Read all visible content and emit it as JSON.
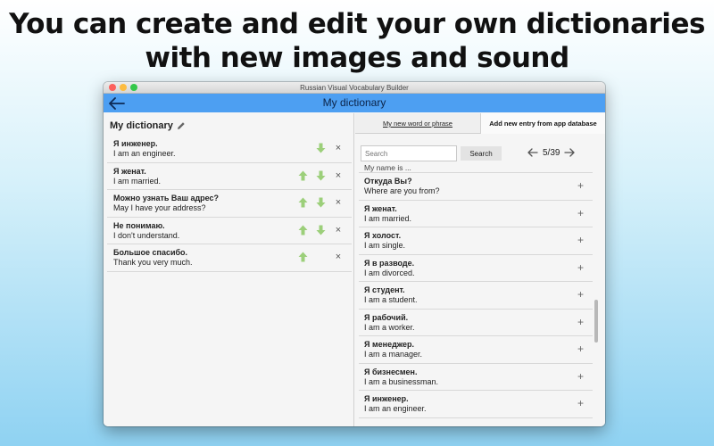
{
  "headline": {
    "line1": "You can create and edit your own dictionaries",
    "line2": "with new images and sound"
  },
  "window": {
    "title": "Russian Visual Vocabulary Builder"
  },
  "appbar": {
    "title": "My dictionary",
    "back_icon": "arrow-left-icon"
  },
  "left_panel": {
    "title": "My dictionary",
    "edit_icon": "pencil-icon",
    "entries": [
      {
        "ru": "Я инженер.",
        "en": "I am an engineer.",
        "up": false,
        "down": true
      },
      {
        "ru": "Я женат.",
        "en": "I am married.",
        "up": true,
        "down": true
      },
      {
        "ru": "Можно узнать Ваш адрес?",
        "en": "May I have your address?",
        "up": true,
        "down": true
      },
      {
        "ru": "Не понимаю.",
        "en": "I don't understand.",
        "up": true,
        "down": true
      },
      {
        "ru": "Большое спасибо.",
        "en": "Thank you very much.",
        "up": true,
        "down": false
      }
    ],
    "remove_glyph": "×"
  },
  "right_panel": {
    "tabs": [
      {
        "label": "My new word or phrase",
        "active": false
      },
      {
        "label": "Add new entry from app database",
        "active": true
      }
    ],
    "search": {
      "placeholder": "Search",
      "button_label": "Search"
    },
    "pager": {
      "text": "5/39"
    },
    "partial_item": "My name is ...",
    "items": [
      {
        "ru": "Откуда Вы?",
        "en": "Where are you from?"
      },
      {
        "ru": "Я женат.",
        "en": "I am married."
      },
      {
        "ru": "Я холост.",
        "en": "I am single."
      },
      {
        "ru": "Я в разводе.",
        "en": "I am divorced."
      },
      {
        "ru": "Я студент.",
        "en": "I am a student."
      },
      {
        "ru": "Я рабочий.",
        "en": "I am a worker."
      },
      {
        "ru": "Я менеджер.",
        "en": "I am a manager."
      },
      {
        "ru": "Я бизнесмен.",
        "en": "I am a businessman."
      },
      {
        "ru": "Я инженер.",
        "en": "I am an engineer."
      }
    ],
    "add_glyph": "+"
  },
  "colors": {
    "appbar": "#4d9ff2",
    "arrow_green": "#9ccf7a"
  }
}
